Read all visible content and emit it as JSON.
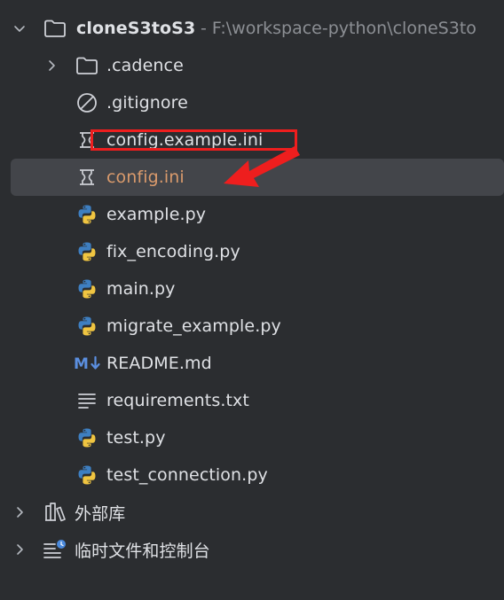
{
  "project": {
    "name": "cloneS3toS3",
    "path": " - F:\\workspace-python\\cloneS3to"
  },
  "files": [
    {
      "label": ".cadence",
      "icon": "folder-icon"
    },
    {
      "label": ".gitignore",
      "icon": "ignore-icon"
    },
    {
      "label": "config.example.ini",
      "icon": "ini-file-icon"
    },
    {
      "label": "config.ini",
      "icon": "ini-file-icon"
    },
    {
      "label": "example.py",
      "icon": "python-icon"
    },
    {
      "label": "fix_encoding.py",
      "icon": "python-icon"
    },
    {
      "label": "main.py",
      "icon": "python-icon"
    },
    {
      "label": "migrate_example.py",
      "icon": "python-icon"
    },
    {
      "label": "README.md",
      "icon": "markdown-icon"
    },
    {
      "label": "requirements.txt",
      "icon": "text-file-icon"
    },
    {
      "label": "test.py",
      "icon": "python-icon"
    },
    {
      "label": "test_connection.py",
      "icon": "python-icon"
    }
  ],
  "external_libraries": {
    "label": "外部库"
  },
  "scratches": {
    "label": "临时文件和控制台"
  },
  "colors": {
    "background": "#2b2d30",
    "selection": "#43454a",
    "modified_text": "#d99a6c",
    "annotation": "#ee1e1e",
    "python_blue": "#3e7fc1",
    "python_yellow": "#f0c541"
  }
}
